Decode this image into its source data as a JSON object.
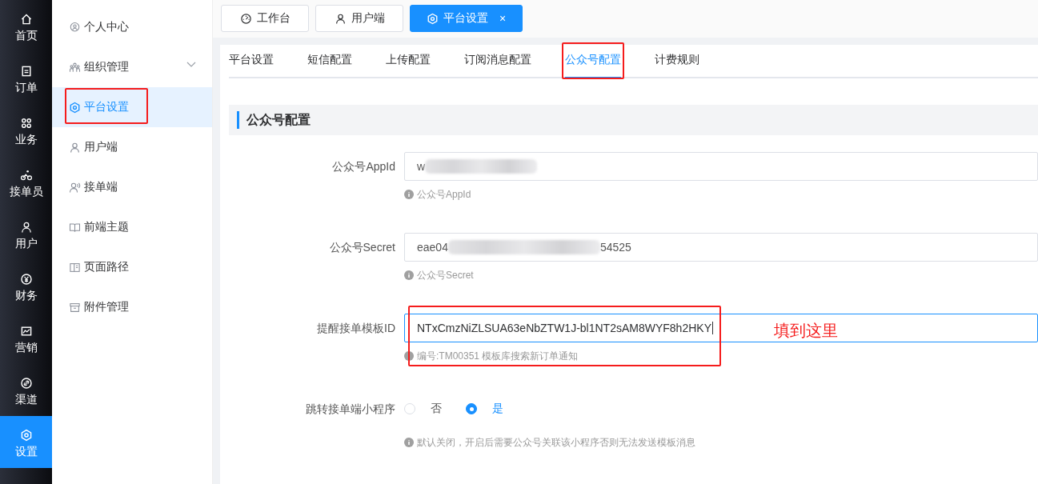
{
  "nav": [
    {
      "label": "首页",
      "selected": false
    },
    {
      "label": "订单",
      "selected": false
    },
    {
      "label": "业务",
      "selected": false
    },
    {
      "label": "接单员",
      "selected": false
    },
    {
      "label": "用户",
      "selected": false
    },
    {
      "label": "财务",
      "selected": false
    },
    {
      "label": "营销",
      "selected": false
    },
    {
      "label": "渠道",
      "selected": false
    },
    {
      "label": "设置",
      "selected": true
    }
  ],
  "sidebar": {
    "items": [
      {
        "label": "个人中心",
        "selected": false,
        "highlighted": false
      },
      {
        "label": "组织管理",
        "selected": false,
        "highlighted": false,
        "expanded": false
      },
      {
        "label": "平台设置",
        "selected": true,
        "highlighted": true
      },
      {
        "label": "用户端",
        "selected": false,
        "highlighted": false
      },
      {
        "label": "接单端",
        "selected": false,
        "highlighted": false
      },
      {
        "label": "前端主题",
        "selected": false,
        "highlighted": false
      },
      {
        "label": "页面路径",
        "selected": false,
        "highlighted": false
      },
      {
        "label": "附件管理",
        "selected": false,
        "highlighted": false
      }
    ]
  },
  "page_tabs": [
    {
      "label": "工作台",
      "selected": false
    },
    {
      "label": "用户端",
      "selected": false
    },
    {
      "label": "平台设置",
      "selected": true,
      "close": "×"
    }
  ],
  "settings_tabs": [
    {
      "label": "平台设置",
      "selected": false,
      "highlighted": false
    },
    {
      "label": "短信配置",
      "selected": false,
      "highlighted": false
    },
    {
      "label": "上传配置",
      "selected": false,
      "highlighted": false
    },
    {
      "label": "订阅消息配置",
      "selected": false,
      "highlighted": false
    },
    {
      "label": "公众号配置",
      "selected": true,
      "highlighted": true
    },
    {
      "label": "计费规则",
      "selected": false,
      "highlighted": false
    }
  ],
  "section": {
    "title": "公众号配置"
  },
  "form": [
    {
      "kind": "input",
      "label": "公众号AppId",
      "value": "w",
      "masked": true,
      "hint": "公众号AppId",
      "focused": false
    },
    {
      "kind": "input",
      "label": "公众号Secret",
      "value": "eae04",
      "masked": true,
      "value_tail": "54525",
      "hint": "公众号Secret",
      "focused": false
    },
    {
      "kind": "input",
      "label": "提醒接单模板ID",
      "value": "NTxCmzNiZLSUA63eNbZTW1J-bl1NT2sAM8WYF8h2HKY",
      "hint": "编号:TM00351 模板库搜索新订单通知",
      "focused": true,
      "highlighted": true,
      "note": "填到这里"
    },
    {
      "kind": "radio",
      "label": "跳转接单端小程序",
      "options": [
        {
          "label": "否",
          "selected": false
        },
        {
          "label": "是",
          "selected": true
        }
      ],
      "hint": "默认关闭，开启后需要公众号关联该小程序否则无法发送模板消息"
    }
  ]
}
